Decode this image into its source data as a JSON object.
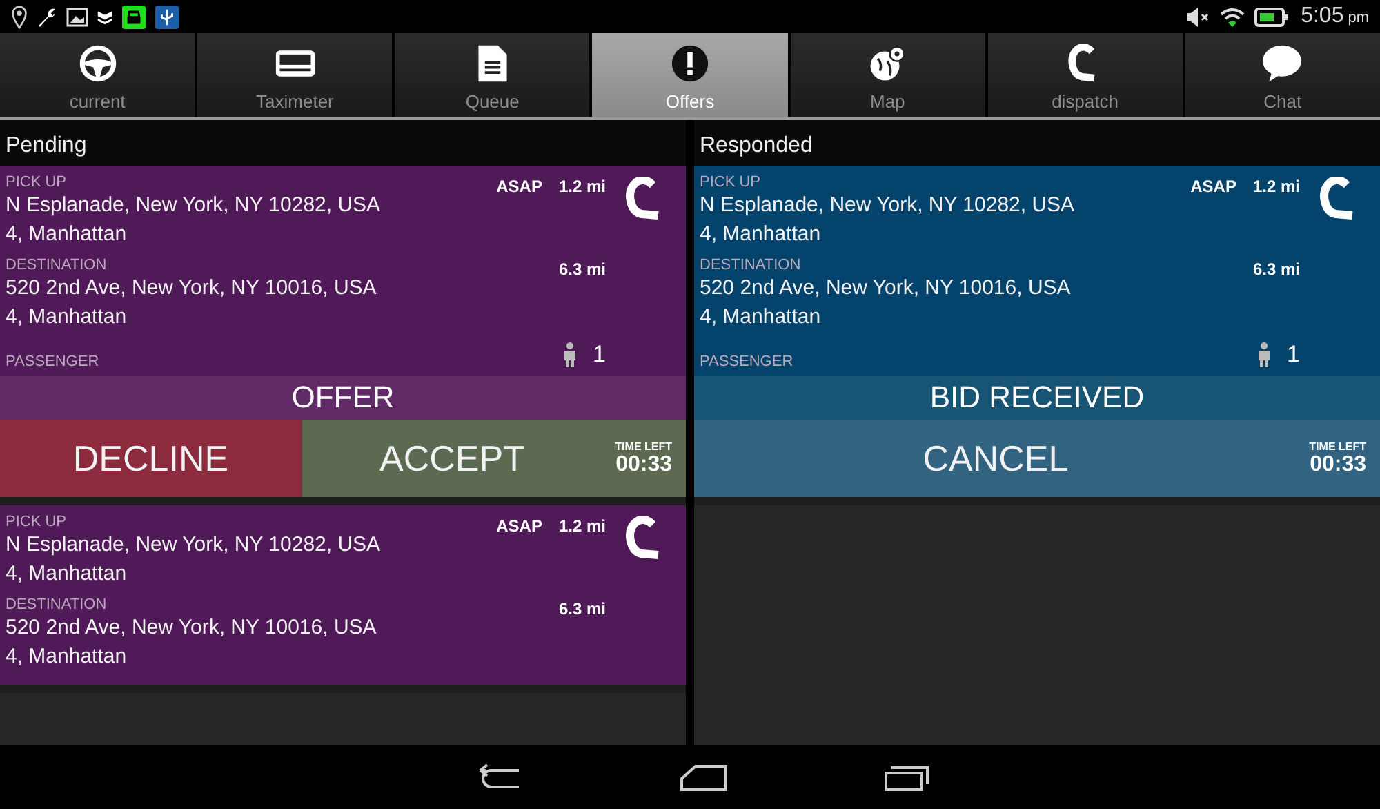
{
  "status_bar": {
    "time": "5:05",
    "ampm": "pm"
  },
  "tabs": [
    {
      "label": "current",
      "selected": false
    },
    {
      "label": "Taximeter",
      "selected": false
    },
    {
      "label": "Queue",
      "selected": false
    },
    {
      "label": "Offers",
      "selected": true
    },
    {
      "label": "Map",
      "selected": false
    },
    {
      "label": "dispatch",
      "selected": false
    },
    {
      "label": "Chat",
      "selected": false
    }
  ],
  "sections": [
    {
      "title": "Pending",
      "kind": "pending",
      "cards": [
        {
          "pickup_label": "PICK UP",
          "pickup_address": "N Esplanade, New York, NY 10282, USA",
          "pickup_area": "4, Manhattan",
          "time": "ASAP",
          "pickup_distance": "1.2 mi",
          "destination_label": "DESTINATION",
          "destination_address": "520 2nd Ave, New York, NY 10016, USA",
          "destination_area": "4, Manhattan",
          "destination_distance": "6.3 mi",
          "passenger_label": "PASSENGER",
          "passengers": "1",
          "status": "OFFER",
          "actions": [
            {
              "label": "DECLINE",
              "kind": "decline"
            },
            {
              "label": "ACCEPT",
              "kind": "accept"
            }
          ],
          "time_left_label": "TIME LEFT",
          "time_left": "00:33"
        },
        {
          "pickup_label": "PICK UP",
          "pickup_address": "N Esplanade, New York, NY 10282, USA",
          "pickup_area": "4, Manhattan",
          "time": "ASAP",
          "pickup_distance": "1.2 mi",
          "destination_label": "DESTINATION",
          "destination_address": "520 2nd Ave, New York, NY 10016, USA",
          "destination_area": "4, Manhattan",
          "destination_distance": "6.3 mi"
        }
      ]
    },
    {
      "title": "Responded",
      "kind": "responded",
      "cards": [
        {
          "pickup_label": "PICK UP",
          "pickup_address": "N Esplanade, New York, NY 10282, USA",
          "pickup_area": "4, Manhattan",
          "time": "ASAP",
          "pickup_distance": "1.2 mi",
          "destination_label": "DESTINATION",
          "destination_address": "520 2nd Ave, New York, NY 10016, USA",
          "destination_area": "4, Manhattan",
          "destination_distance": "6.3 mi",
          "passenger_label": "PASSENGER",
          "passengers": "1",
          "status": "BID RECEIVED",
          "actions": [
            {
              "label": "CANCEL",
              "kind": "cancel"
            }
          ],
          "time_left_label": "TIME LEFT",
          "time_left": "00:33"
        }
      ]
    }
  ]
}
